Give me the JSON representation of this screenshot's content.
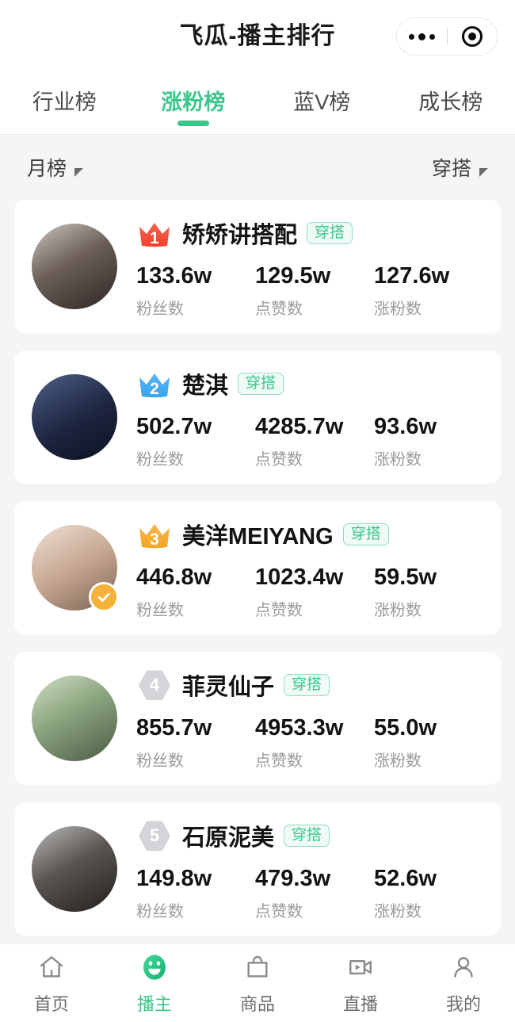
{
  "navbar": {
    "title": "飞瓜-播主排行",
    "capsule": {
      "more_icon": "more-dots-icon",
      "target_icon": "target-circle-icon"
    }
  },
  "tabs": [
    {
      "label": "行业榜",
      "active": false
    },
    {
      "label": "涨粉榜",
      "active": true
    },
    {
      "label": "蓝V榜",
      "active": false
    },
    {
      "label": "成长榜",
      "active": false
    }
  ],
  "filters": {
    "period": {
      "label": "月榜",
      "caret_icon": "triangle-down-icon"
    },
    "category": {
      "label": "穿搭",
      "caret_icon": "triangle-down-icon"
    }
  },
  "stat_labels": {
    "fans": "粉丝数",
    "likes": "点赞数",
    "growth": "涨粉数"
  },
  "colors": {
    "accent_green": "#3dc68b",
    "rank1": "#f5402c",
    "rank2": "#35a5f0",
    "rank3": "#f5a623",
    "rank_gray": "#d3d5d8",
    "verify_badge": "#f6b13a",
    "page_bg": "#f4f5f6"
  },
  "ranking": [
    {
      "rank": "1",
      "badge_type": "crown",
      "badge_color": "#f5402c",
      "name": "矫矫讲搭配",
      "tag": "穿搭",
      "verified": false,
      "avatar_name": "avatar-jiaojiao",
      "fans": "133.6w",
      "likes": "129.5w",
      "growth": "127.6w"
    },
    {
      "rank": "2",
      "badge_type": "crown",
      "badge_color": "#35a5f0",
      "name": "楚淇",
      "tag": "穿搭",
      "verified": false,
      "avatar_name": "avatar-chuqi",
      "fans": "502.7w",
      "likes": "4285.7w",
      "growth": "93.6w"
    },
    {
      "rank": "3",
      "badge_type": "crown",
      "badge_color": "#f5a623",
      "name": "美洋MEIYANG",
      "tag": "穿搭",
      "verified": true,
      "avatar_name": "avatar-meiyang",
      "fans": "446.8w",
      "likes": "1023.4w",
      "growth": "59.5w"
    },
    {
      "rank": "4",
      "badge_type": "hex",
      "badge_color": "#d3d5d8",
      "name": "菲灵仙子",
      "tag": "穿搭",
      "verified": false,
      "avatar_name": "avatar-feilingxianzi",
      "fans": "855.7w",
      "likes": "4953.3w",
      "growth": "55.0w"
    },
    {
      "rank": "5",
      "badge_type": "hex",
      "badge_color": "#d3d5d8",
      "name": "石原泥美",
      "tag": "穿搭",
      "verified": false,
      "avatar_name": "avatar-shiyuannimei",
      "fans": "149.8w",
      "likes": "479.3w",
      "growth": "52.6w"
    }
  ],
  "bottom_nav": [
    {
      "label": "首页",
      "icon": "home-icon",
      "active": false
    },
    {
      "label": "播主",
      "icon": "smiley-face-icon",
      "active": true
    },
    {
      "label": "商品",
      "icon": "shopping-bag-icon",
      "active": false
    },
    {
      "label": "直播",
      "icon": "video-camera-icon",
      "active": false
    },
    {
      "label": "我的",
      "icon": "person-icon",
      "active": false
    }
  ]
}
